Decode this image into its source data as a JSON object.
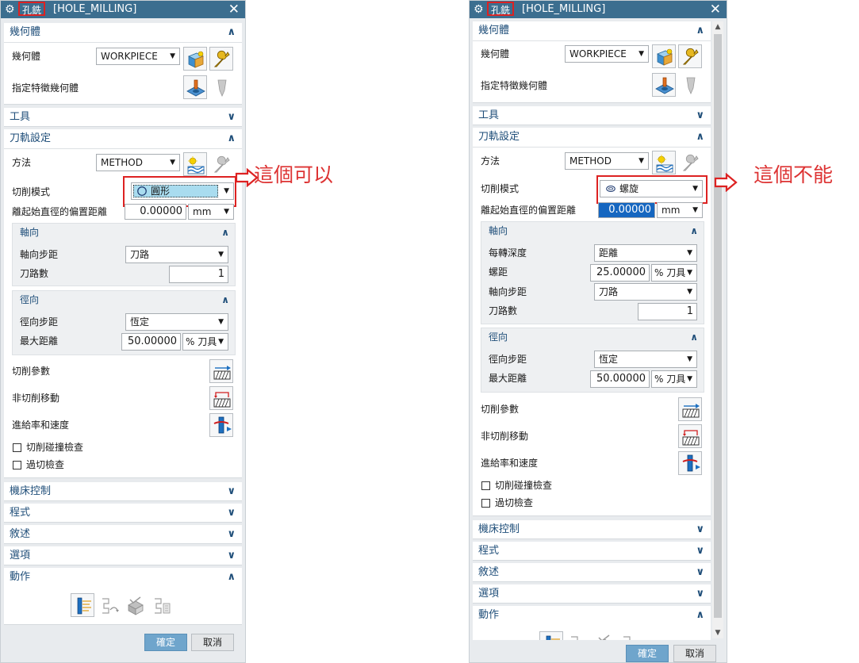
{
  "dialog": {
    "tag": "孔銑",
    "title": "[HOLE_MILLING]",
    "geometry": {
      "header": "幾何體",
      "label": "幾何體",
      "value": "WORKPIECE",
      "feature_label": "指定特徵幾何體"
    },
    "tool": {
      "header": "工具"
    },
    "path": {
      "header": "刀軌設定",
      "method_label": "方法",
      "method_value": "METHOD",
      "cut_mode_label": "切削模式",
      "offset_label": "離起始直徑的偏置距離",
      "offset_unit": "mm"
    },
    "axial": {
      "header": "軸向",
      "step_label": "軸向步距",
      "step_value": "刀路",
      "passes_label": "刀路數",
      "passes_value": "1",
      "depth_label": "每轉深度",
      "depth_value": "距離",
      "pitch_label": "螺距"
    },
    "radial": {
      "header": "徑向",
      "step_label": "徑向步距",
      "step_value": "恆定",
      "max_label": "最大距離",
      "max_value": "50.00000",
      "max_unit": "% 刀具"
    },
    "params": {
      "cut_params": "切削參數",
      "non_cut": "非切削移動",
      "feeds": "進給率和速度",
      "collision": "切削碰撞檢查",
      "gouge": "過切檢查"
    },
    "collapsed": {
      "machine": "機床控制",
      "program": "程式",
      "desc": "敘述",
      "options": "選項",
      "action": "動作"
    },
    "buttons": {
      "ok": "確定",
      "cancel": "取消"
    }
  },
  "left": {
    "cut_mode_value": "圓形",
    "offset_value": "0.00000",
    "annotation": "這個可以"
  },
  "right": {
    "cut_mode_value": "螺旋",
    "offset_value": "0.00000",
    "pitch_value": "25.00000",
    "pitch_unit": "% 刀具",
    "annotation": "這個不能"
  },
  "colors": {
    "title_bar": "#3c6e8f",
    "header_text": "#1f4e79",
    "highlight": "#d22222",
    "selected_field": "#1566c0"
  },
  "icons": [
    "settings-gear-icon",
    "close-icon",
    "geometry-cube-icon",
    "wrench-icon",
    "feature-geometry-icon",
    "method-icon",
    "cut-params-icon",
    "non-cut-moves-icon",
    "feeds-speeds-icon",
    "generate-icon",
    "replay-icon",
    "verify-icon",
    "list-icon",
    "red-arrow-icon"
  ]
}
